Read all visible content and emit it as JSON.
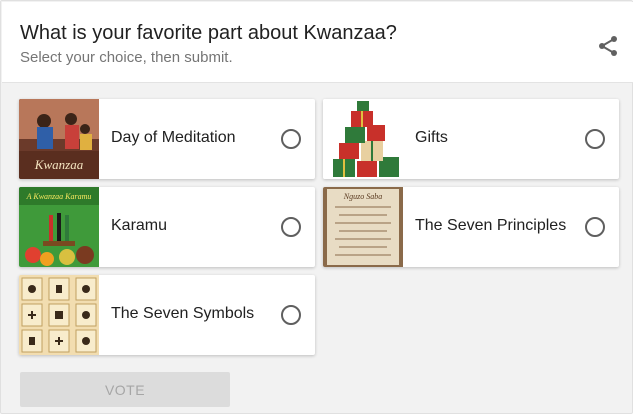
{
  "poll": {
    "question": "What is your favorite part about Kwanzaa?",
    "instruction": "Select your choice, then submit.",
    "share_icon": "share-icon",
    "options": [
      {
        "label": "Day of Meditation",
        "image_text": "Kwanzaa",
        "selected": false
      },
      {
        "label": "Gifts",
        "selected": false
      },
      {
        "label": "Karamu",
        "image_text": "A Kwanzaa Karamu",
        "selected": false
      },
      {
        "label": "The Seven Principles",
        "image_text": "Nguzo Saba",
        "selected": false
      },
      {
        "label": "The Seven Symbols",
        "selected": false
      }
    ],
    "vote_label": "VOTE",
    "vote_enabled": false
  },
  "colors": {
    "background": "#f2f2f2",
    "card": "#ffffff",
    "radio_border": "#5f5f5f",
    "vote_disabled_bg": "#dcdcdc",
    "vote_disabled_text": "#a6a6a6"
  }
}
